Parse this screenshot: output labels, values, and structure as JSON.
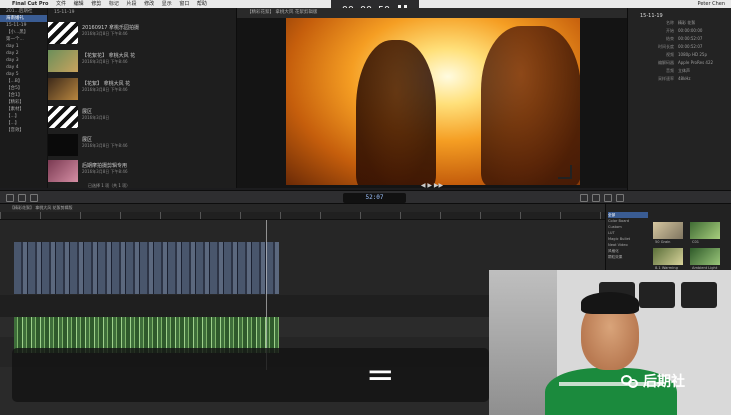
{
  "menubar": {
    "app": "Final Cut Pro",
    "items": [
      "文件",
      "编辑",
      "修剪",
      "标记",
      "片段",
      "修改",
      "显示",
      "窗口",
      "帮助"
    ],
    "right": "Peter Chen"
  },
  "recorder": {
    "time": "00:00:50"
  },
  "sidebar": {
    "items": [
      "201...后期社",
      "海南婚礼",
      "15-11-19",
      "【小...黑】",
      "第一个...",
      "day 1",
      "day 2",
      "day 3",
      "day 4",
      "day 5",
      "【...B】",
      "【合5】",
      "【合1】",
      "【精彩】",
      "【素材】",
      "【...】",
      "【...】",
      "【音效】"
    ],
    "selected_index": 1
  },
  "browser": {
    "header": "15-11-19",
    "clips": [
      {
        "title": "20160917 拿桃乐园拍摄",
        "meta": [
          "2016年3月8日 下午8:46",
          "2016年3月8日"
        ]
      },
      {
        "title": "【花絮花】 拿桃大风 花",
        "meta": [
          "2016年3月8日 下午8:46"
        ]
      },
      {
        "title": "【花絮】 拿桃大风 花",
        "meta": [
          "2016年3月8日 下午8:46"
        ]
      },
      {
        "title": "展区",
        "meta": [
          "2016年3月8日"
        ]
      },
      {
        "title": "展区",
        "meta": [
          "2016年3月8日 下午8:46"
        ]
      },
      {
        "title": "后期摩拍摄剪辑专用",
        "meta": [
          "2016年3月8日 下午8:46"
        ]
      }
    ],
    "footer": "已选择 1 项（共 1 项）"
  },
  "viewer": {
    "title": "【精彩花絮】 拿桃大风 花絮剪辑版"
  },
  "inspector": {
    "title": "15-11-19",
    "rows": [
      {
        "k": "名称",
        "v": "精彩 花絮"
      },
      {
        "k": "开始",
        "v": "00:00:00:00"
      },
      {
        "k": "结束",
        "v": "00:00:52:07"
      },
      {
        "k": "时间长度",
        "v": "00:00:52:07"
      },
      {
        "k": "视频",
        "v": "1080p HD 25p"
      },
      {
        "k": "编解码器",
        "v": "Apple ProRes 422"
      },
      {
        "k": "音频",
        "v": "立体声"
      },
      {
        "k": "采样速率",
        "v": "48kHz"
      }
    ]
  },
  "toolbar": {
    "timecode": "52:07"
  },
  "timeline": {
    "header": "【精彩花絮】 拿桃大风 花絮剪辑版"
  },
  "effects": {
    "list": [
      "全部",
      "Color Board",
      "Custom",
      "LUT",
      "Magic Bullet",
      "Neat Video",
      "风格化",
      "颗粒效果"
    ],
    "selected_index": 0,
    "thumbs": [
      {
        "label": "50 Grain"
      },
      {
        "label": "C01"
      },
      {
        "label": "8.1 Warming"
      },
      {
        "label": "Ambient Light"
      }
    ]
  },
  "watermark": {
    "text": "后期社"
  },
  "overlay": {
    "symbol": "="
  }
}
